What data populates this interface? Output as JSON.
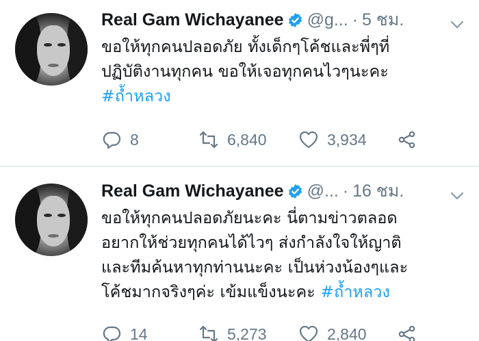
{
  "tweets": [
    {
      "author_name": "Real Gam Wichayanee",
      "handle": "@g...",
      "separator": "·",
      "time": "5 ชม.",
      "lines": [
        "ขอให้ทุกคนปลอดภัย ทั้งเด็กๆโค้ชและพี่ๆที่",
        "ปฏิบัติงานทุกคน ขอให้เจอทุกคนไวๆนะคะ"
      ],
      "hashtag": "#ถ้ำหลวง",
      "replies": "8",
      "retweets": "6,840",
      "likes": "3,934"
    },
    {
      "author_name": "Real Gam Wichayanee",
      "handle": "@...",
      "separator": "·",
      "time": "16 ชม.",
      "lines": [
        "ขอให้ทุกคนปลอดภัยนะคะ นี่ตามข่าวตลอด",
        "อยากให้ช่วยทุกคนได้ไวๆ ส่งกำลังใจให้ญาติ",
        "และทีมค้นหาทุกท่านนะคะ เป็นห่วงน้องๆและ",
        "โค้ชมากจริงๆค่ะ เข้มแข็งนะคะ "
      ],
      "hashtag": "#ถ้ำหลวง",
      "replies": "14",
      "retweets": "5,273",
      "likes": "2,840"
    }
  ],
  "icons": {
    "verified": "verified-badge-icon",
    "menu": "chevron-down-icon",
    "reply": "reply-icon",
    "retweet": "retweet-icon",
    "like": "heart-icon",
    "share": "share-icon"
  },
  "colors": {
    "text": "#14171a",
    "secondary": "#657786",
    "link": "#1da1f2",
    "verified": "#1da1f2",
    "divider": "#e6ecf0"
  }
}
